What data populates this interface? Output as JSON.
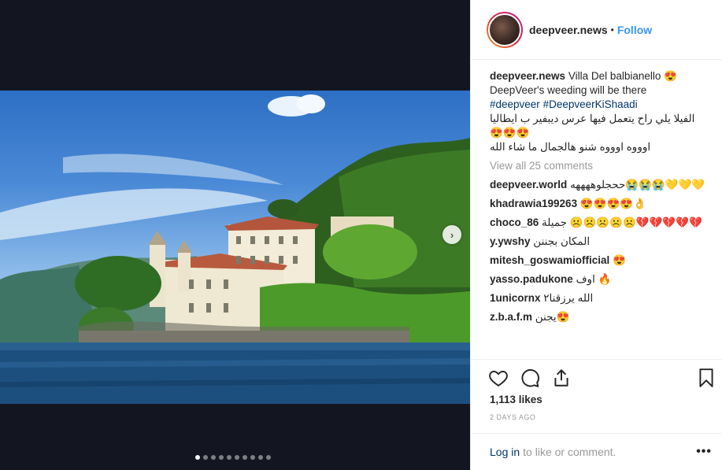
{
  "post": {
    "dots_count": 10,
    "active_dot": 0
  },
  "header": {
    "username": "deepveer.news",
    "separator": "•",
    "follow_label": "Follow"
  },
  "caption": {
    "username": "deepveer.news",
    "line1": "Villa Del balbianello 😍",
    "line2": "DeepVeer's weeding will be there",
    "hashtag1": "#deepveer",
    "hashtag2": "#DeepveerKiShaadi",
    "line4": "الفيلا يلي راح يتعمل فيها عرس ديبفير ب ايطاليا",
    "line5": "😍😍😍",
    "line6": "اوووه اوووه شنو هالجمال ما شاء الله"
  },
  "view_all": "View all 25 comments",
  "comments": [
    {
      "user": "deepveer.world",
      "text": "ححجلوههههه😭😭😭💛💛💛"
    },
    {
      "user": "khadrawia199263",
      "text": "😍😍😍😍👌"
    },
    {
      "user": "choco_86",
      "text": "جميلة ☹️☹️☹️☹️☹️💔💔💔💔💔"
    },
    {
      "user": "y.ywshy",
      "text": "المكان بجننن"
    },
    {
      "user": "mitesh_goswamiofficial",
      "text": "😍"
    },
    {
      "user": "yasso.padukone",
      "text": "اوف 🔥"
    },
    {
      "user": "1unicornx",
      "text": "الله يرزقنا٢"
    },
    {
      "user": "z.b.a.f.m",
      "text": "يجنن😍"
    }
  ],
  "likes": "1,113 likes",
  "time_ago": "2 days ago",
  "footer": {
    "login_label": "Log in",
    "rest": "to like or comment.",
    "more": "•••"
  }
}
